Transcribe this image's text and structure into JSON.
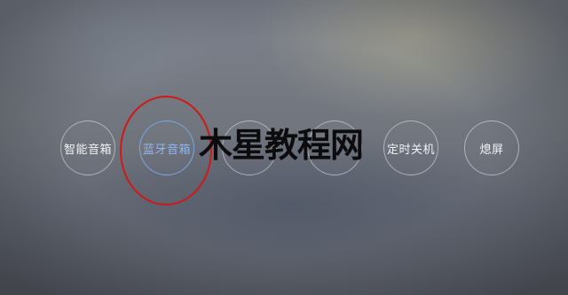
{
  "menu": {
    "items": [
      {
        "label": "智能音箱",
        "state": "normal"
      },
      {
        "label": "蓝牙音箱",
        "state": "selected"
      },
      {
        "label": "",
        "state": "normal"
      },
      {
        "label": "",
        "state": "normal"
      },
      {
        "label": "定时关机",
        "state": "normal"
      },
      {
        "label": "熄屏",
        "state": "normal"
      }
    ]
  },
  "overlay": {
    "watermark": "木星教程网"
  },
  "colors": {
    "selected_accent": "#8fb6f0",
    "annotation_ring": "#d01818",
    "button_border": "#e6e8ee"
  }
}
